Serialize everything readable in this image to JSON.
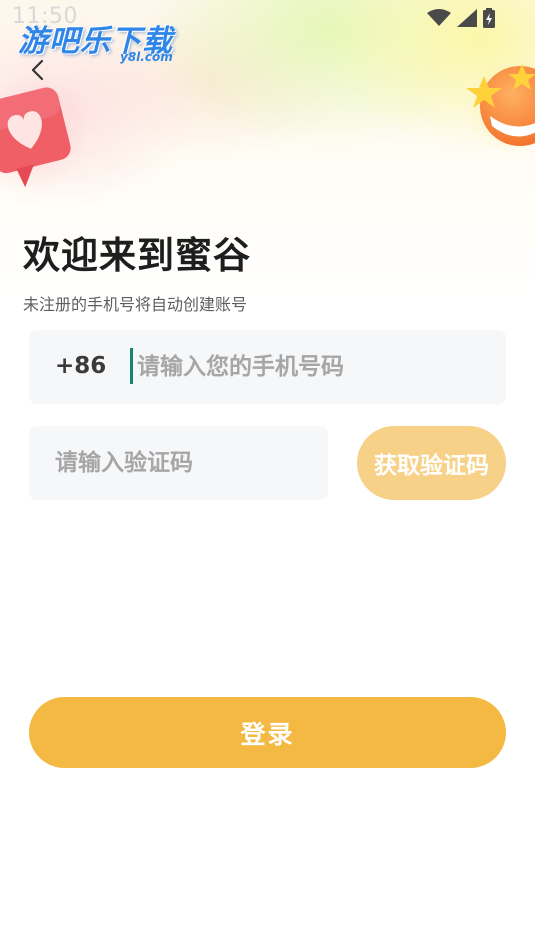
{
  "status_bar": {
    "time": "11:50",
    "icons": [
      "wifi-icon",
      "signal-icon",
      "battery-icon"
    ]
  },
  "watermark": {
    "main": "游吧乐下载",
    "sub": "y8l.com"
  },
  "header": {
    "title": "欢迎来到蜜谷",
    "subtitle": "未注册的手机号将自动创建账号"
  },
  "phone": {
    "country_code": "+86",
    "placeholder": "请输入您的手机号码",
    "value": ""
  },
  "verification": {
    "placeholder": "请输入验证码",
    "value": "",
    "get_code_label": "获取验证码"
  },
  "login": {
    "label": "登录"
  },
  "colors": {
    "accent": "#f4b942",
    "get_code_button": "#f8d188",
    "input_background": "#f6f7f9",
    "caret": "#12876f"
  }
}
